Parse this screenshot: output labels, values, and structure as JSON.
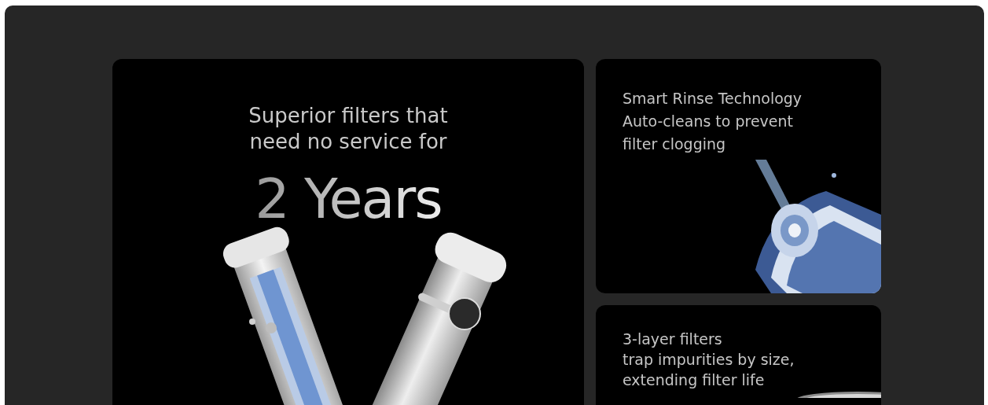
{
  "hero": {
    "heading_lines": [
      "Superior filters that",
      "need no service for"
    ],
    "highlight": "2 Years",
    "picture": {
      "kind": "picture"
    }
  },
  "features": [
    {
      "lines": [
        "Smart Rinse Technology",
        "Auto-cleans to prevent",
        "filter clogging"
      ],
      "picture": {
        "kind": "picture"
      }
    },
    {
      "lines": [
        "3-layer filters",
        "trap impurities by size,",
        "extending filter life"
      ],
      "picture": {
        "kind": "picture"
      }
    }
  ]
}
